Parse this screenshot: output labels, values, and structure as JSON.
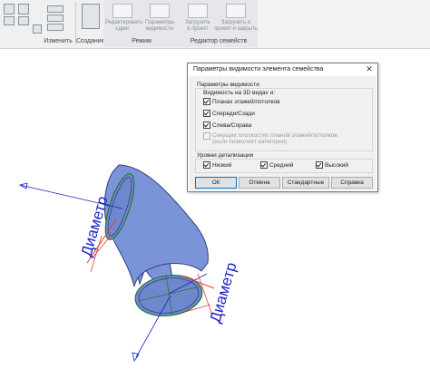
{
  "ribbon": {
    "panels": [
      {
        "label": "Изменить"
      },
      {
        "label": "Создание"
      }
    ],
    "mode": {
      "buttons": [
        {
          "label_line1": "Редактировать",
          "label_line2": "сдвиг"
        },
        {
          "label_line1": "Параметры",
          "label_line2": "видимости"
        }
      ],
      "label": "Режим"
    },
    "family_editor": {
      "buttons": [
        {
          "label_line1": "Загрузить",
          "label_line2": "в проект"
        },
        {
          "label_line1": "Загрузить в",
          "label_line2": "проект и закрыть"
        }
      ],
      "label": "Редактор семейств"
    }
  },
  "dialog": {
    "title": "Параметры видимости элемента семейства",
    "close_glyph": "✕",
    "visibility_group": "Параметры видимости",
    "visible_3d_label": "Видимость на 3D видах и:",
    "checkboxes": [
      {
        "label": "Планах этажей/потолков",
        "checked": true
      },
      {
        "label": "Спереди/Сзади",
        "checked": true
      },
      {
        "label": "Слева/Справа",
        "checked": true
      }
    ],
    "section_cut": {
      "line1": "Секущих плоскостях планов этажей/потолков",
      "line2": "(если позволяет категория)",
      "checked": false,
      "disabled": true
    },
    "detail_group": "Уровни детализации",
    "detail_levels": [
      {
        "label": "Низкий",
        "checked": true
      },
      {
        "label": "Средний",
        "checked": true
      },
      {
        "label": "Высокий",
        "checked": true
      }
    ],
    "buttons": {
      "ok": "ОК",
      "cancel": "Отмена",
      "defaults": "Стандартные",
      "help": "Справка"
    }
  },
  "canvas": {
    "dimension_label_1": "Диаметр",
    "dimension_label_2": "Диаметр"
  },
  "colors": {
    "elbow_fill": "#7b94d8",
    "elbow_edge": "#2e3f88",
    "dimension": "#1a22c8",
    "reference": "#e83a3a",
    "axis": "#2a7a2a"
  }
}
